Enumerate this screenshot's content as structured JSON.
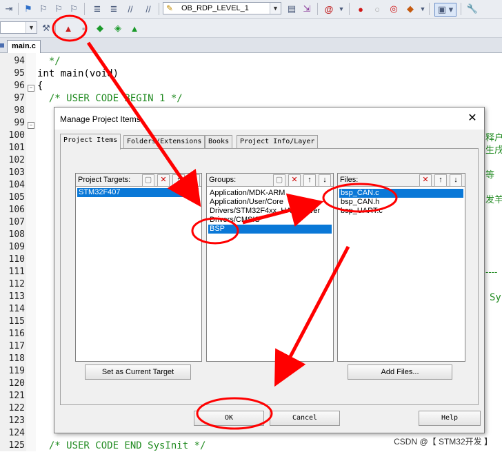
{
  "toolbar1": {
    "target_combo": "OB_RDP_LEVEL_1"
  },
  "editor": {
    "tab": "main.c",
    "line_numbers": [
      "94",
      "95",
      "96",
      "97",
      "98",
      "99",
      "100",
      "101",
      "102",
      "103",
      "104",
      "105",
      "106",
      "107",
      "108",
      "109",
      "110",
      "111",
      "112",
      "113",
      "114",
      "115",
      "116",
      "117",
      "118",
      "119",
      "120",
      "121",
      "122",
      "123",
      "124",
      "125"
    ],
    "code_lines": {
      "l94": "  */",
      "l95": "int main(void)",
      "l96": "{",
      "l97": "  /* USER CODE BEGIN 1 */",
      "l125": "  /* USER CODE END SysInit */"
    },
    "right_fragments": {
      "f1": "释户",
      "f2": "生戌",
      "f3": "等",
      "f4": "发羊",
      "f5": "----",
      "f6": "Sy"
    }
  },
  "dialog": {
    "title": "Manage Project Items",
    "close": "✕",
    "tabs": [
      "Project Items",
      "Folders/Extensions",
      "Books",
      "Project Info/Layer"
    ],
    "targets": {
      "header": "Project Targets:",
      "items": [
        "STM32F407"
      ],
      "set_current_button": "Set as Current Target"
    },
    "groups": {
      "header": "Groups:",
      "items": [
        "Application/MDK-ARM",
        "Application/User/Core",
        "Drivers/STM32F4xx_HAL_Driver",
        "Drivers/CMSIS",
        "BSP"
      ]
    },
    "files": {
      "header": "Files:",
      "items": [
        "bsp_CAN.c",
        "bsp_CAN.h",
        "bsp_UART.c"
      ],
      "add_button": "Add Files..."
    },
    "ok": "OK",
    "cancel": "Cancel",
    "help": "Help"
  },
  "watermark": "CSDN @【 STM32开发 】",
  "colors": {
    "selection": "#0a78d7",
    "annotation": "#ff0000",
    "comment": "#218b21"
  }
}
